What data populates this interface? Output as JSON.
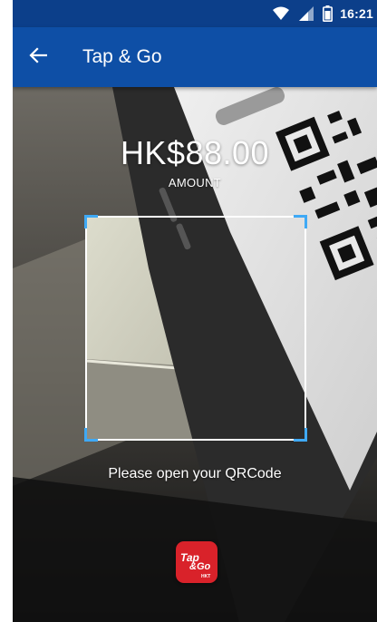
{
  "status_bar": {
    "time": "16:21",
    "icons": [
      "wifi-icon",
      "signal-icon",
      "battery-icon"
    ]
  },
  "app_bar": {
    "back_icon": "arrow-left-icon",
    "title": "Tap & Go"
  },
  "payment": {
    "amount": "HK$88.00",
    "amount_label": "AMOUNT"
  },
  "scanner": {
    "instruction": "Please open your QRCode",
    "frame_corner_color": "#3fa9f5"
  },
  "brand": {
    "logo_text": "Tap&Go",
    "logo_subtext": "HKT",
    "logo_color": "#d9222a"
  },
  "colors": {
    "status_bar": "#0c3f8a",
    "app_bar": "#0e4fa6"
  }
}
